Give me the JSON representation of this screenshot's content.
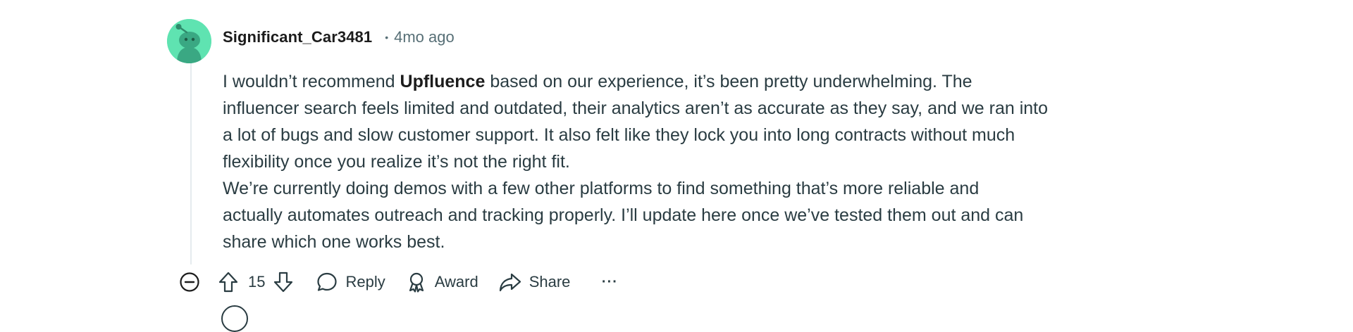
{
  "comment": {
    "author": "Significant_Car3481",
    "separator": "•",
    "time_ago": "4mo ago",
    "body": {
      "p1_before": "I wouldn’t recommend ",
      "p1_bold": "Upfluence",
      "p1_line1_after": " based on our experience, it’s been pretty underwhelming. The",
      "p1_line2": "influencer search feels limited and outdated, their analytics aren’t as accurate as they say, and we ran into",
      "p1_line3": "a lot of bugs and slow customer support. It also felt like they lock you into long contracts without much",
      "p1_line4": "flexibility once you realize it’s not the right fit.",
      "p2_line1": "We’re currently doing demos with a few other platforms to find something that’s more reliable and",
      "p2_line2": "actually automates outreach and tracking properly. I’ll update here once we’ve tested them out and can",
      "p2_line3": "share which one works best."
    },
    "actions": {
      "vote_count": "15",
      "reply_label": "Reply",
      "award_label": "Award",
      "share_label": "Share",
      "more_label": "···"
    }
  },
  "icons": {
    "collapse": "minus-circle-icon",
    "upvote": "arrow-up-icon",
    "downvote": "arrow-down-icon",
    "reply": "speech-bubble-icon",
    "award": "award-ribbon-icon",
    "share": "share-arrow-icon",
    "more": "ellipsis-icon",
    "avatar": "snoo-avatar-icon"
  },
  "colors": {
    "avatar_bg": "#5fe3b1",
    "text_primary": "#1c1c1c",
    "text_secondary": "#576f76",
    "thread_line": "#e5ebee"
  }
}
